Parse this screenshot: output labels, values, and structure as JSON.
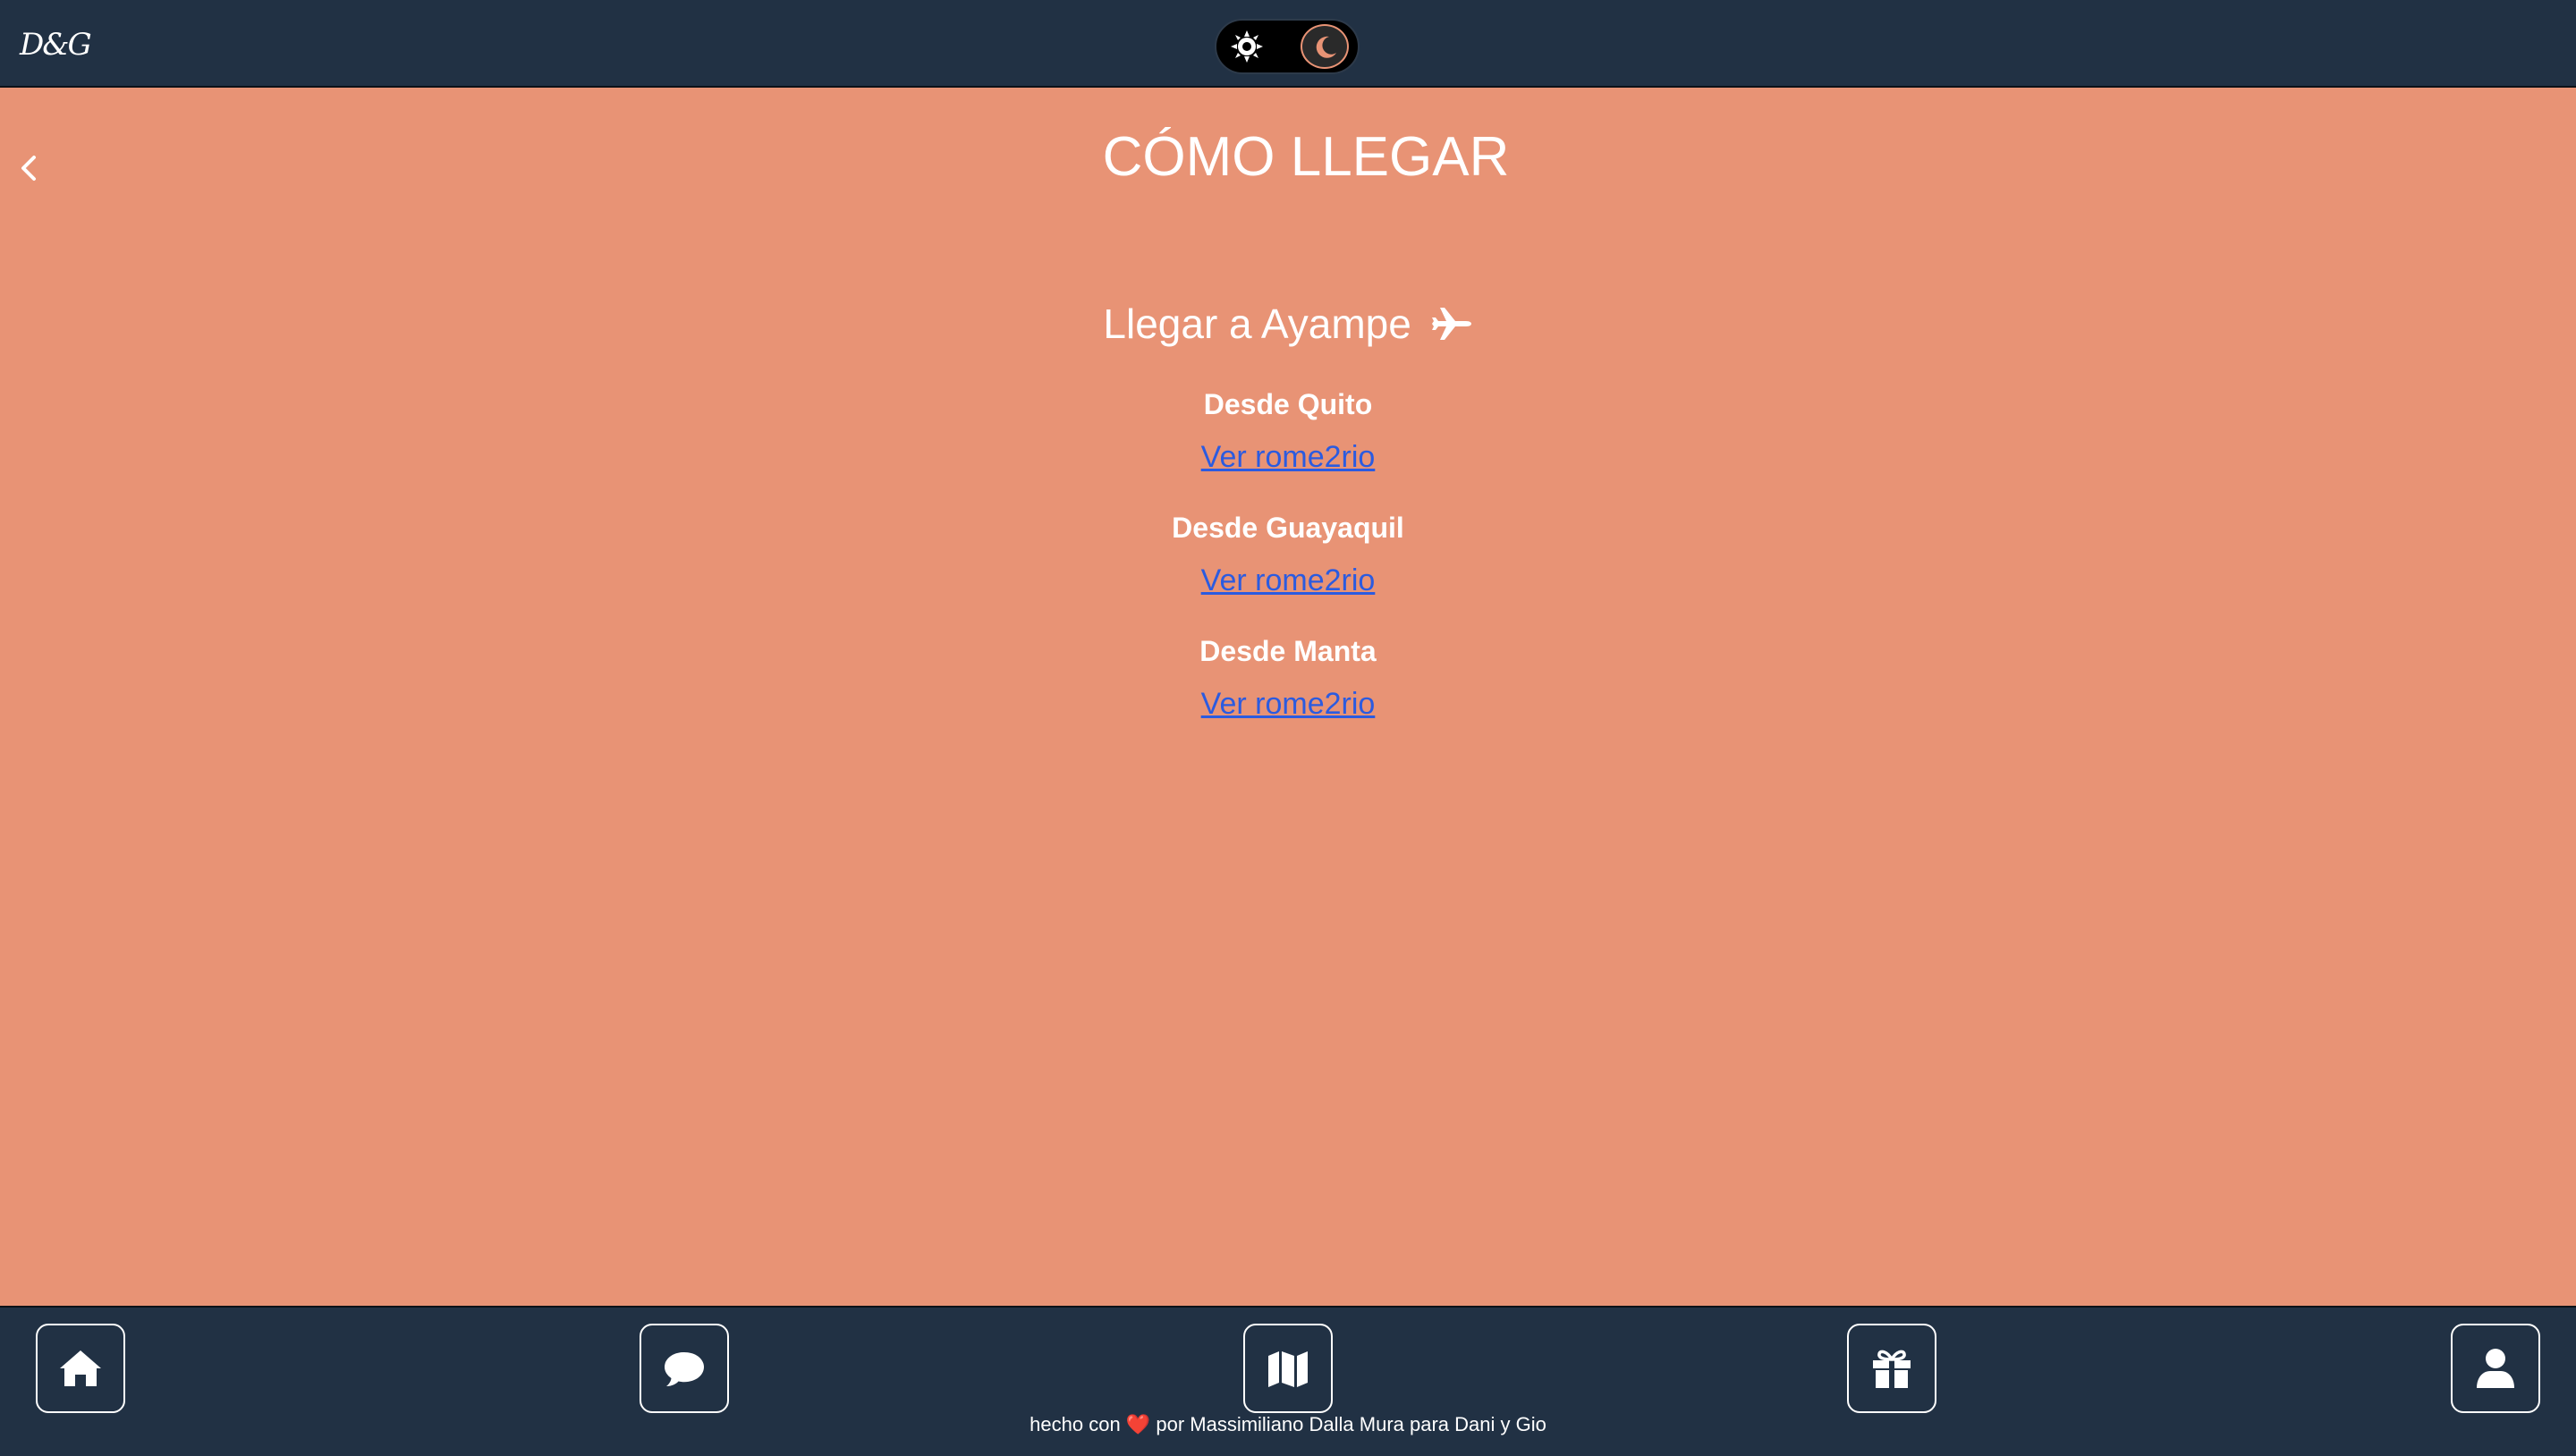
{
  "header": {
    "logo": "D&G",
    "theme_toggle": {
      "light_icon": "sun-icon",
      "dark_icon": "moon-icon",
      "active": "dark"
    }
  },
  "page": {
    "back_icon": "chevron-left-icon",
    "title": "CÓMO LLEGAR"
  },
  "section": {
    "title": "Llegar a Ayampe",
    "title_icon": "airplane-icon",
    "routes": [
      {
        "label": "Desde Quito",
        "link": "Ver rome2rio"
      },
      {
        "label": "Desde Guayaquil",
        "link": "Ver rome2rio"
      },
      {
        "label": "Desde Manta",
        "link": "Ver rome2rio"
      }
    ]
  },
  "bottom_nav": {
    "items": [
      {
        "icon": "home-icon"
      },
      {
        "icon": "chat-bubble-icon"
      },
      {
        "icon": "map-icon"
      },
      {
        "icon": "gift-icon"
      },
      {
        "icon": "user-icon"
      }
    ],
    "footer_before": "hecho con",
    "footer_heart": "❤️",
    "footer_after": "por Massimiliano Dalla Mura para Dani y Gio"
  },
  "colors": {
    "background": "#e89375",
    "bar": "#213144",
    "link": "#2b5be0",
    "text": "#ffffff"
  }
}
